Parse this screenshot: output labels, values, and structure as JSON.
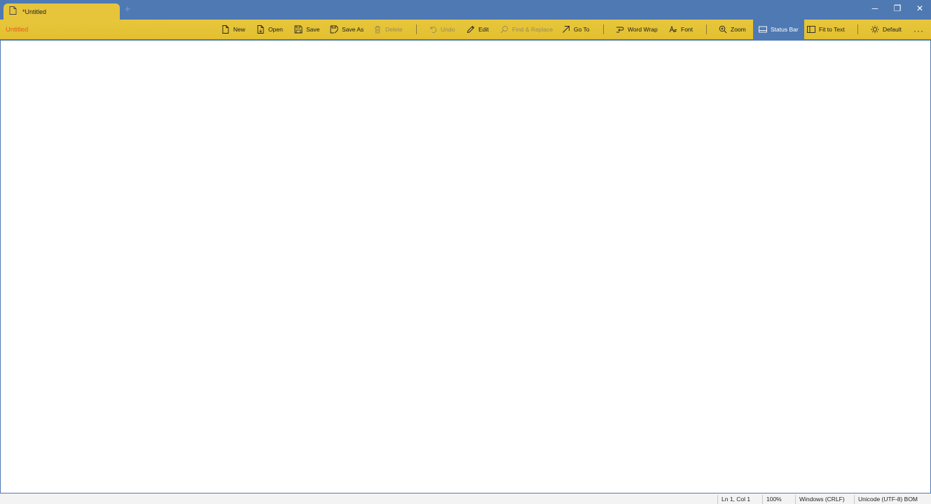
{
  "tab": {
    "title": "*Untitled",
    "new_tab_symbol": "+"
  },
  "window": {
    "minimize": "─",
    "restore": "❐",
    "close": "✕"
  },
  "document": {
    "name": "Untitled",
    "name_color": "#e85b1c"
  },
  "toolbar": {
    "new": "New",
    "open": "Open",
    "save": "Save",
    "save_as": "Save As",
    "delete": "Delete",
    "undo": "Undo",
    "edit": "Edit",
    "find_replace": "Find & Replace",
    "go_to": "Go To",
    "word_wrap": "Word Wrap",
    "font": "Font",
    "zoom": "Zoom",
    "status_bar": "Status Bar",
    "fit_to_text": "Fit to Text",
    "theme": "Default",
    "more": "···"
  },
  "editor": {
    "content": ""
  },
  "status_bar": {
    "position": "Ln 1, Col 1",
    "zoom": "100%",
    "line_ending": "Windows (CRLF)",
    "encoding": "Unicode (UTF-8) BOM"
  },
  "colors": {
    "accent": "#4f79b3",
    "toolbar": "#e5c335",
    "tab": "#e7c53b"
  }
}
